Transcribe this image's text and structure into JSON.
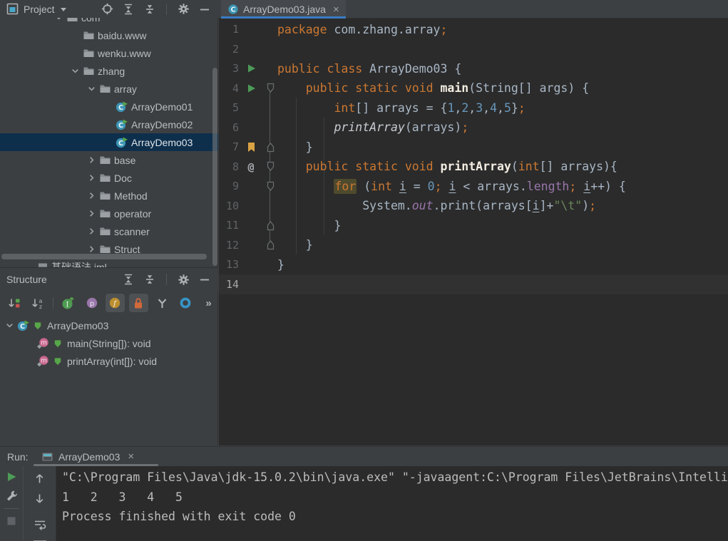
{
  "colors": {
    "panel_bg": "#3C3F41",
    "editor_bg": "#2B2B2B",
    "accent_tab_blue": "#3A7CC4",
    "selection_blue": "#0E2F4C",
    "keyword_orange": "#CC7832",
    "number_blue": "#6897BB",
    "string_green": "#6A8759",
    "field_purple": "#9876AA",
    "run_green": "#4C9B57",
    "bookmark_gold": "#D9A343"
  },
  "project_panel": {
    "title": "Project",
    "header_icons": [
      {
        "name": "locate"
      },
      {
        "name": "expand-all"
      },
      {
        "name": "collapse-all"
      },
      {
        "name": "separator"
      },
      {
        "name": "settings"
      },
      {
        "name": "hide"
      }
    ],
    "tree": [
      {
        "indent": 3,
        "chevron": "down",
        "icon": "folder",
        "label": "com"
      },
      {
        "indent": 4,
        "chevron": null,
        "icon": "folder",
        "label": "baidu.www"
      },
      {
        "indent": 4,
        "chevron": null,
        "icon": "folder",
        "label": "wenku.www"
      },
      {
        "indent": 4,
        "chevron": "down",
        "icon": "folder",
        "label": "zhang"
      },
      {
        "indent": 5,
        "chevron": "down",
        "icon": "folder",
        "label": "array"
      },
      {
        "indent": 6,
        "chevron": null,
        "icon": "class",
        "label": "ArrayDemo01"
      },
      {
        "indent": 6,
        "chevron": null,
        "icon": "class",
        "label": "ArrayDemo02"
      },
      {
        "indent": 6,
        "chevron": null,
        "icon": "class",
        "label": "ArrayDemo03",
        "selected": true
      },
      {
        "indent": 5,
        "chevron": "right",
        "icon": "folder",
        "label": "base"
      },
      {
        "indent": 5,
        "chevron": "right",
        "icon": "folder",
        "label": "Doc"
      },
      {
        "indent": 5,
        "chevron": "right",
        "icon": "folder",
        "label": "Method"
      },
      {
        "indent": 5,
        "chevron": "right",
        "icon": "folder",
        "label": "operator"
      },
      {
        "indent": 5,
        "chevron": "right",
        "icon": "folder",
        "label": "scanner"
      },
      {
        "indent": 5,
        "chevron": "right",
        "icon": "folder",
        "label": "Struct"
      },
      {
        "indent": 2,
        "chevron": null,
        "icon": "module",
        "label": "基础语法.iml"
      }
    ]
  },
  "structure_panel": {
    "title": "Structure",
    "header_icons": [
      {
        "name": "expand-all"
      },
      {
        "name": "collapse-all"
      },
      {
        "name": "separator"
      },
      {
        "name": "settings"
      },
      {
        "name": "hide"
      }
    ],
    "toolbar_icons": [
      {
        "name": "sort-visibility"
      },
      {
        "name": "sort-alpha"
      },
      {
        "name": "separator"
      },
      {
        "name": "show-inherited"
      },
      {
        "name": "show-properties"
      },
      {
        "name": "show-fields",
        "toggled": true
      },
      {
        "name": "show-non-public",
        "toggled": true
      },
      {
        "name": "group-filter"
      },
      {
        "name": "show-anonymous"
      },
      {
        "name": "more-chevrons"
      }
    ],
    "tree": [
      {
        "indent": 0,
        "chevron": "down",
        "icon": "class",
        "vis": true,
        "label": "ArrayDemo03"
      },
      {
        "indent": 1,
        "chevron": null,
        "icon": "method",
        "vis": true,
        "label": "main(String[]): void"
      },
      {
        "indent": 1,
        "chevron": null,
        "icon": "method",
        "vis": true,
        "label": "printArray(int[]): void"
      }
    ]
  },
  "editor": {
    "tab": {
      "icon": "class-plain",
      "title": "ArrayDemo03.java",
      "close": "×"
    },
    "lines": [
      {
        "n": 1,
        "tokens": [
          [
            "kw",
            "package"
          ],
          [
            "d",
            " com.zhang.array"
          ],
          [
            "sc",
            ";"
          ]
        ]
      },
      {
        "n": 2,
        "tokens": []
      },
      {
        "n": 3,
        "gutter": "run",
        "tokens": [
          [
            "kw",
            "public class"
          ],
          [
            "d",
            " ArrayDemo03 {"
          ]
        ]
      },
      {
        "n": 4,
        "gutter": "run",
        "fold": "start",
        "tokens": [
          [
            "d",
            "    "
          ],
          [
            "kw",
            "public static void"
          ],
          [
            "d",
            " "
          ],
          [
            "decl",
            "main"
          ],
          [
            "d",
            "(String[] args) {"
          ]
        ]
      },
      {
        "n": 5,
        "tokens": [
          [
            "d",
            "        "
          ],
          [
            "kw",
            "int"
          ],
          [
            "d",
            "[] arrays = {"
          ],
          [
            "num",
            "1"
          ],
          [
            "d",
            ","
          ],
          [
            "num",
            "2"
          ],
          [
            "d",
            ","
          ],
          [
            "num",
            "3"
          ],
          [
            "d",
            ","
          ],
          [
            "num",
            "4"
          ],
          [
            "d",
            ","
          ],
          [
            "num",
            "5"
          ],
          [
            "d",
            "}"
          ],
          [
            "sc",
            ";"
          ]
        ]
      },
      {
        "n": 6,
        "tokens": [
          [
            "d",
            "        "
          ],
          [
            "call",
            "printArray"
          ],
          [
            "d",
            "(arrays)"
          ],
          [
            "sc",
            ";"
          ]
        ]
      },
      {
        "n": 7,
        "gutter": "bookmark",
        "fold": "end",
        "tokens": [
          [
            "d",
            "    }"
          ]
        ]
      },
      {
        "n": 8,
        "gutter": "at",
        "fold": "start",
        "tokens": [
          [
            "d",
            "    "
          ],
          [
            "kw",
            "public static void"
          ],
          [
            "d",
            " "
          ],
          [
            "decl",
            "printArray"
          ],
          [
            "d",
            "("
          ],
          [
            "kw",
            "int"
          ],
          [
            "d",
            "[] arrays){"
          ]
        ]
      },
      {
        "n": 9,
        "fold": "start",
        "tokens": [
          [
            "d",
            "        "
          ],
          [
            "kwhl",
            "for"
          ],
          [
            "d",
            " ("
          ],
          [
            "kw",
            "int"
          ],
          [
            "d",
            " "
          ],
          [
            "u",
            "i"
          ],
          [
            "d",
            " = "
          ],
          [
            "num",
            "0"
          ],
          [
            "sc",
            ";"
          ],
          [
            "d",
            " "
          ],
          [
            "u",
            "i"
          ],
          [
            "d",
            " < arrays."
          ],
          [
            "fld",
            "length"
          ],
          [
            "sc",
            ";"
          ],
          [
            "d",
            " "
          ],
          [
            "u",
            "i"
          ],
          [
            "d",
            "++) {"
          ]
        ]
      },
      {
        "n": 10,
        "tokens": [
          [
            "d",
            "            System."
          ],
          [
            "fldi",
            "out"
          ],
          [
            "d",
            ".print(arrays["
          ],
          [
            "u",
            "i"
          ],
          [
            "d",
            "]+"
          ],
          [
            "str",
            "\"\\t\""
          ],
          [
            "d",
            ")"
          ],
          [
            "sc",
            ";"
          ]
        ]
      },
      {
        "n": 11,
        "fold": "end",
        "tokens": [
          [
            "d",
            "        }"
          ]
        ]
      },
      {
        "n": 12,
        "fold": "end",
        "tokens": [
          [
            "d",
            "    }"
          ]
        ]
      },
      {
        "n": 13,
        "tokens": [
          [
            "d",
            "}"
          ]
        ]
      },
      {
        "n": 14,
        "current": true,
        "tokens": []
      }
    ]
  },
  "run_panel": {
    "label": "Run:",
    "tab": {
      "icon": "console",
      "title": "ArrayDemo03",
      "close": "×"
    },
    "toolbar_left": [
      {
        "name": "rerun"
      },
      {
        "name": "edit-configuration"
      },
      {
        "name": "separator-h"
      },
      {
        "name": "stop"
      }
    ],
    "toolbar_nav": [
      {
        "name": "up"
      },
      {
        "name": "down"
      },
      {
        "name": "soft-wrap"
      }
    ],
    "console": [
      "\"C:\\Program Files\\Java\\jdk-15.0.2\\bin\\java.exe\" \"-javaagent:C:\\Program Files\\JetBrains\\Intelli",
      "1   2   3   4   5",
      "Process finished with exit code 0"
    ]
  }
}
